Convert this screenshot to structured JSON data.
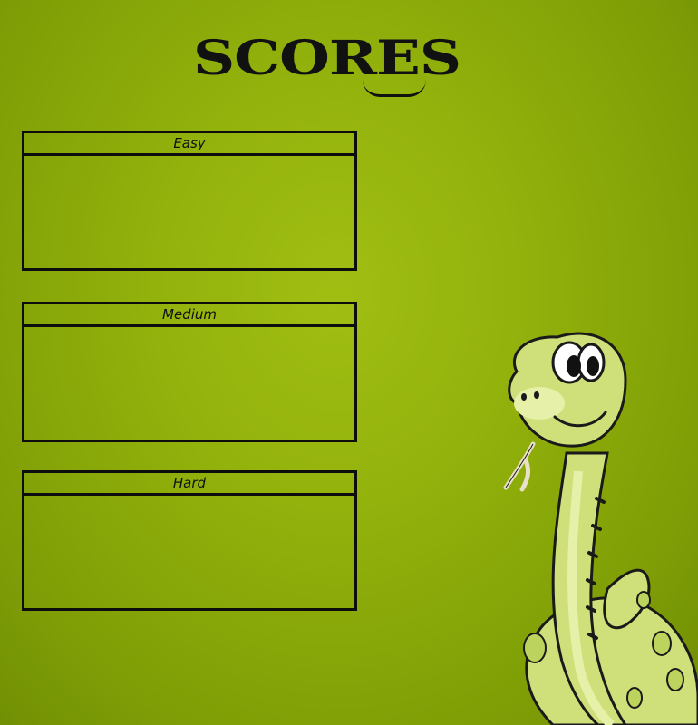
{
  "screen": {
    "title": "SCORES"
  },
  "panels": [
    {
      "label": "Easy",
      "scores": []
    },
    {
      "label": "Medium",
      "scores": []
    },
    {
      "label": "Hard",
      "scores": []
    }
  ],
  "colors": {
    "background": "#93b20c",
    "border": "#0d0d0d",
    "snake_body": "#cfe07a",
    "snake_outline": "#1a1a1a"
  },
  "icons": {
    "mascot": "cartoon-snake-icon"
  }
}
